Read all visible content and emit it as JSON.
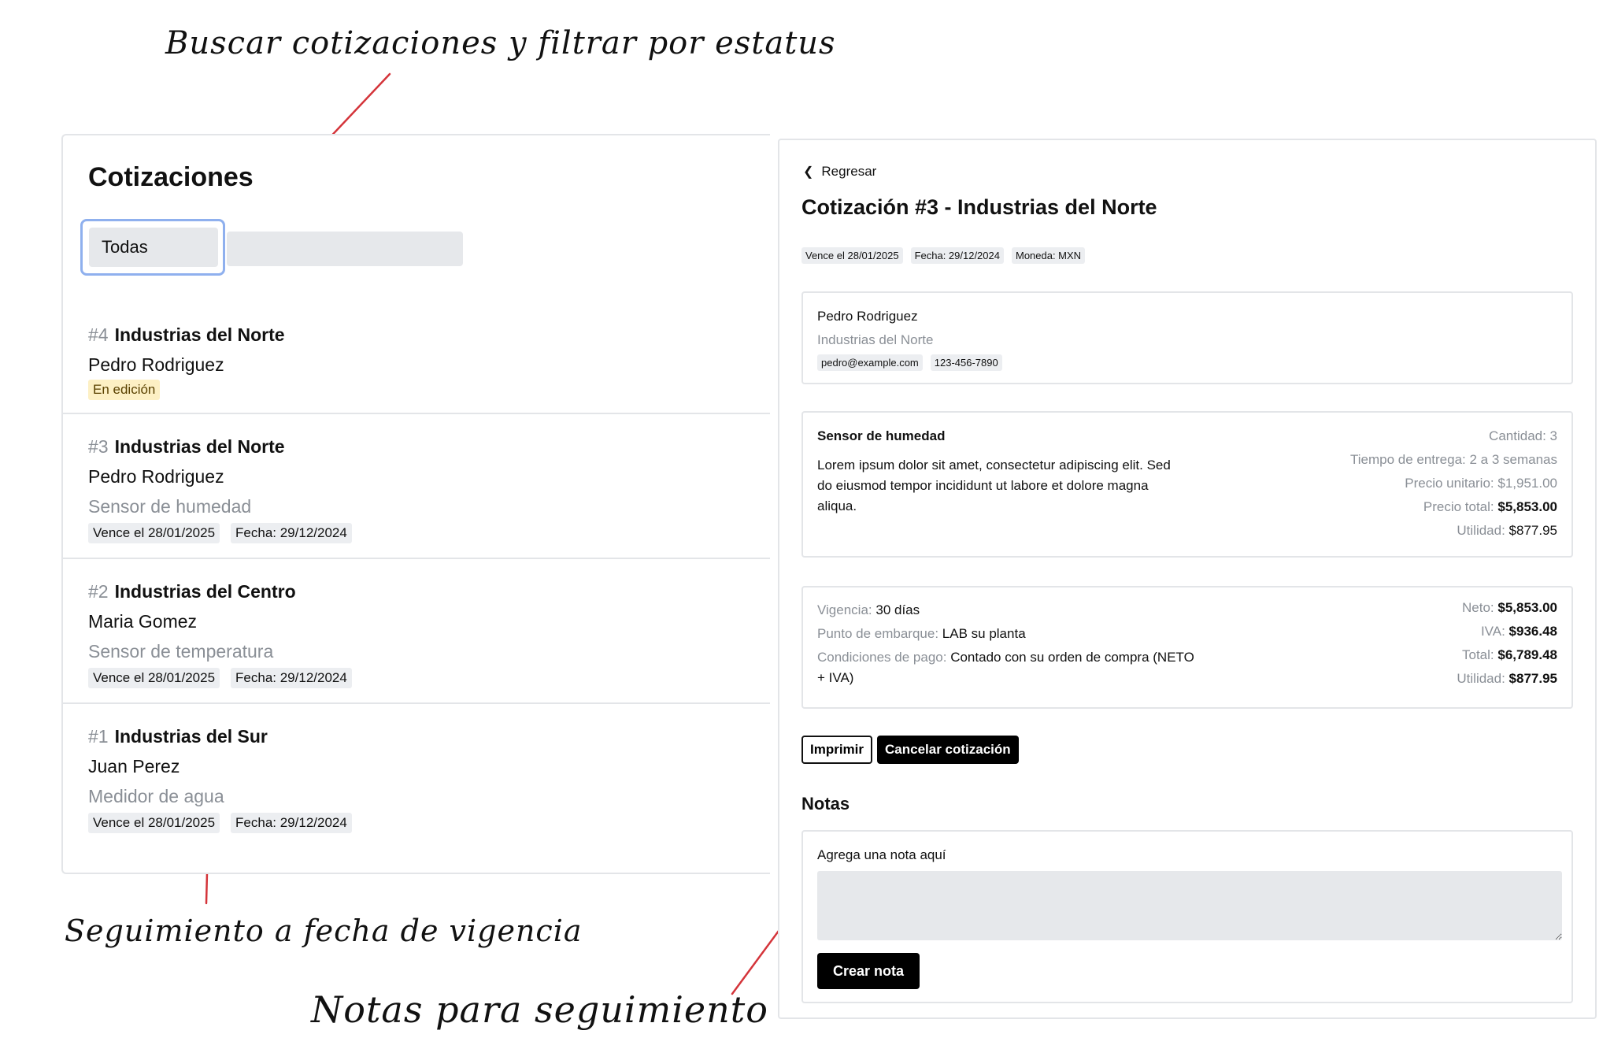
{
  "annotations": {
    "top": "Buscar cotizaciones y filtrar por estatus",
    "vigencia": "Seguimiento a fecha de vigencia",
    "notas": "Notas para seguimiento"
  },
  "list": {
    "title": "Cotizaciones",
    "filter_value": "Todas",
    "items": [
      {
        "num": "#4",
        "company": "Industrias del Norte",
        "contact": "Pedro Rodriguez",
        "status": "En edición"
      },
      {
        "num": "#3",
        "company": "Industrias del Norte",
        "contact": "Pedro Rodriguez",
        "product": "Sensor de humedad",
        "due": "Vence el 28/01/2025",
        "date": "Fecha: 29/12/2024"
      },
      {
        "num": "#2",
        "company": "Industrias del Centro",
        "contact": "Maria Gomez",
        "product": "Sensor de temperatura",
        "due": "Vence el 28/01/2025",
        "date": "Fecha: 29/12/2024"
      },
      {
        "num": "#1",
        "company": "Industrias del Sur",
        "contact": "Juan Perez",
        "product": "Medidor de agua",
        "due": "Vence el 28/01/2025",
        "date": "Fecha: 29/12/2024"
      }
    ]
  },
  "detail": {
    "back": "Regresar",
    "title": "Cotización #3 - Industrias del Norte",
    "tags": [
      "Vence el 28/01/2025",
      "Fecha: 29/12/2024",
      "Moneda: MXN"
    ],
    "contact": {
      "name": "Pedro Rodriguez",
      "company": "Industrias del Norte",
      "email": "pedro@example.com",
      "phone": "123-456-7890"
    },
    "product": {
      "name": "Sensor de humedad",
      "description": "Lorem ipsum dolor sit amet, consectetur adipiscing elit. Sed do eiusmod tempor incididunt ut labore et dolore magna aliqua.",
      "qty": "Cantidad: 3",
      "lead_time": "Tiempo de entrega: 2 a 3 semanas",
      "unit_price": "Precio unitario: $1,951.00",
      "total_label": "Precio total:",
      "total_value": "$5,853.00",
      "profit_label": "Utilidad:",
      "profit_value": "$877.95"
    },
    "terms": {
      "validity_label": "Vigencia:",
      "validity": "30 días",
      "shipping_label": "Punto de embarque:",
      "shipping": "LAB su planta",
      "payment_label": "Condiciones de pago:",
      "payment": "Contado con su orden de compra (NETO + IVA)",
      "net_label": "Neto:",
      "net": "$5,853.00",
      "iva_label": "IVA:",
      "iva": "$936.48",
      "total_label": "Total:",
      "total": "$6,789.48",
      "profit_label": "Utilidad:",
      "profit": "$877.95"
    },
    "buttons": {
      "print": "Imprimir",
      "cancel": "Cancelar cotización"
    },
    "notes": {
      "title": "Notas",
      "label": "Agrega una nota aquí",
      "create": "Crear nota"
    }
  }
}
